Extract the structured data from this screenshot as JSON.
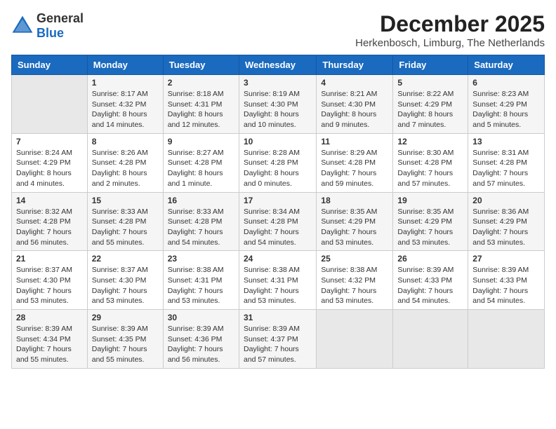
{
  "header": {
    "logo_general": "General",
    "logo_blue": "Blue",
    "month_year": "December 2025",
    "location": "Herkenbosch, Limburg, The Netherlands"
  },
  "days_of_week": [
    "Sunday",
    "Monday",
    "Tuesday",
    "Wednesday",
    "Thursday",
    "Friday",
    "Saturday"
  ],
  "weeks": [
    [
      {
        "day": "",
        "sunrise": "",
        "sunset": "",
        "daylight": ""
      },
      {
        "day": "1",
        "sunrise": "Sunrise: 8:17 AM",
        "sunset": "Sunset: 4:32 PM",
        "daylight": "Daylight: 8 hours and 14 minutes."
      },
      {
        "day": "2",
        "sunrise": "Sunrise: 8:18 AM",
        "sunset": "Sunset: 4:31 PM",
        "daylight": "Daylight: 8 hours and 12 minutes."
      },
      {
        "day": "3",
        "sunrise": "Sunrise: 8:19 AM",
        "sunset": "Sunset: 4:30 PM",
        "daylight": "Daylight: 8 hours and 10 minutes."
      },
      {
        "day": "4",
        "sunrise": "Sunrise: 8:21 AM",
        "sunset": "Sunset: 4:30 PM",
        "daylight": "Daylight: 8 hours and 9 minutes."
      },
      {
        "day": "5",
        "sunrise": "Sunrise: 8:22 AM",
        "sunset": "Sunset: 4:29 PM",
        "daylight": "Daylight: 8 hours and 7 minutes."
      },
      {
        "day": "6",
        "sunrise": "Sunrise: 8:23 AM",
        "sunset": "Sunset: 4:29 PM",
        "daylight": "Daylight: 8 hours and 5 minutes."
      }
    ],
    [
      {
        "day": "7",
        "sunrise": "Sunrise: 8:24 AM",
        "sunset": "Sunset: 4:29 PM",
        "daylight": "Daylight: 8 hours and 4 minutes."
      },
      {
        "day": "8",
        "sunrise": "Sunrise: 8:26 AM",
        "sunset": "Sunset: 4:28 PM",
        "daylight": "Daylight: 8 hours and 2 minutes."
      },
      {
        "day": "9",
        "sunrise": "Sunrise: 8:27 AM",
        "sunset": "Sunset: 4:28 PM",
        "daylight": "Daylight: 8 hours and 1 minute."
      },
      {
        "day": "10",
        "sunrise": "Sunrise: 8:28 AM",
        "sunset": "Sunset: 4:28 PM",
        "daylight": "Daylight: 8 hours and 0 minutes."
      },
      {
        "day": "11",
        "sunrise": "Sunrise: 8:29 AM",
        "sunset": "Sunset: 4:28 PM",
        "daylight": "Daylight: 7 hours and 59 minutes."
      },
      {
        "day": "12",
        "sunrise": "Sunrise: 8:30 AM",
        "sunset": "Sunset: 4:28 PM",
        "daylight": "Daylight: 7 hours and 57 minutes."
      },
      {
        "day": "13",
        "sunrise": "Sunrise: 8:31 AM",
        "sunset": "Sunset: 4:28 PM",
        "daylight": "Daylight: 7 hours and 57 minutes."
      }
    ],
    [
      {
        "day": "14",
        "sunrise": "Sunrise: 8:32 AM",
        "sunset": "Sunset: 4:28 PM",
        "daylight": "Daylight: 7 hours and 56 minutes."
      },
      {
        "day": "15",
        "sunrise": "Sunrise: 8:33 AM",
        "sunset": "Sunset: 4:28 PM",
        "daylight": "Daylight: 7 hours and 55 minutes."
      },
      {
        "day": "16",
        "sunrise": "Sunrise: 8:33 AM",
        "sunset": "Sunset: 4:28 PM",
        "daylight": "Daylight: 7 hours and 54 minutes."
      },
      {
        "day": "17",
        "sunrise": "Sunrise: 8:34 AM",
        "sunset": "Sunset: 4:28 PM",
        "daylight": "Daylight: 7 hours and 54 minutes."
      },
      {
        "day": "18",
        "sunrise": "Sunrise: 8:35 AM",
        "sunset": "Sunset: 4:29 PM",
        "daylight": "Daylight: 7 hours and 53 minutes."
      },
      {
        "day": "19",
        "sunrise": "Sunrise: 8:35 AM",
        "sunset": "Sunset: 4:29 PM",
        "daylight": "Daylight: 7 hours and 53 minutes."
      },
      {
        "day": "20",
        "sunrise": "Sunrise: 8:36 AM",
        "sunset": "Sunset: 4:29 PM",
        "daylight": "Daylight: 7 hours and 53 minutes."
      }
    ],
    [
      {
        "day": "21",
        "sunrise": "Sunrise: 8:37 AM",
        "sunset": "Sunset: 4:30 PM",
        "daylight": "Daylight: 7 hours and 53 minutes."
      },
      {
        "day": "22",
        "sunrise": "Sunrise: 8:37 AM",
        "sunset": "Sunset: 4:30 PM",
        "daylight": "Daylight: 7 hours and 53 minutes."
      },
      {
        "day": "23",
        "sunrise": "Sunrise: 8:38 AM",
        "sunset": "Sunset: 4:31 PM",
        "daylight": "Daylight: 7 hours and 53 minutes."
      },
      {
        "day": "24",
        "sunrise": "Sunrise: 8:38 AM",
        "sunset": "Sunset: 4:31 PM",
        "daylight": "Daylight: 7 hours and 53 minutes."
      },
      {
        "day": "25",
        "sunrise": "Sunrise: 8:38 AM",
        "sunset": "Sunset: 4:32 PM",
        "daylight": "Daylight: 7 hours and 53 minutes."
      },
      {
        "day": "26",
        "sunrise": "Sunrise: 8:39 AM",
        "sunset": "Sunset: 4:33 PM",
        "daylight": "Daylight: 7 hours and 54 minutes."
      },
      {
        "day": "27",
        "sunrise": "Sunrise: 8:39 AM",
        "sunset": "Sunset: 4:33 PM",
        "daylight": "Daylight: 7 hours and 54 minutes."
      }
    ],
    [
      {
        "day": "28",
        "sunrise": "Sunrise: 8:39 AM",
        "sunset": "Sunset: 4:34 PM",
        "daylight": "Daylight: 7 hours and 55 minutes."
      },
      {
        "day": "29",
        "sunrise": "Sunrise: 8:39 AM",
        "sunset": "Sunset: 4:35 PM",
        "daylight": "Daylight: 7 hours and 55 minutes."
      },
      {
        "day": "30",
        "sunrise": "Sunrise: 8:39 AM",
        "sunset": "Sunset: 4:36 PM",
        "daylight": "Daylight: 7 hours and 56 minutes."
      },
      {
        "day": "31",
        "sunrise": "Sunrise: 8:39 AM",
        "sunset": "Sunset: 4:37 PM",
        "daylight": "Daylight: 7 hours and 57 minutes."
      },
      {
        "day": "",
        "sunrise": "",
        "sunset": "",
        "daylight": ""
      },
      {
        "day": "",
        "sunrise": "",
        "sunset": "",
        "daylight": ""
      },
      {
        "day": "",
        "sunrise": "",
        "sunset": "",
        "daylight": ""
      }
    ]
  ]
}
